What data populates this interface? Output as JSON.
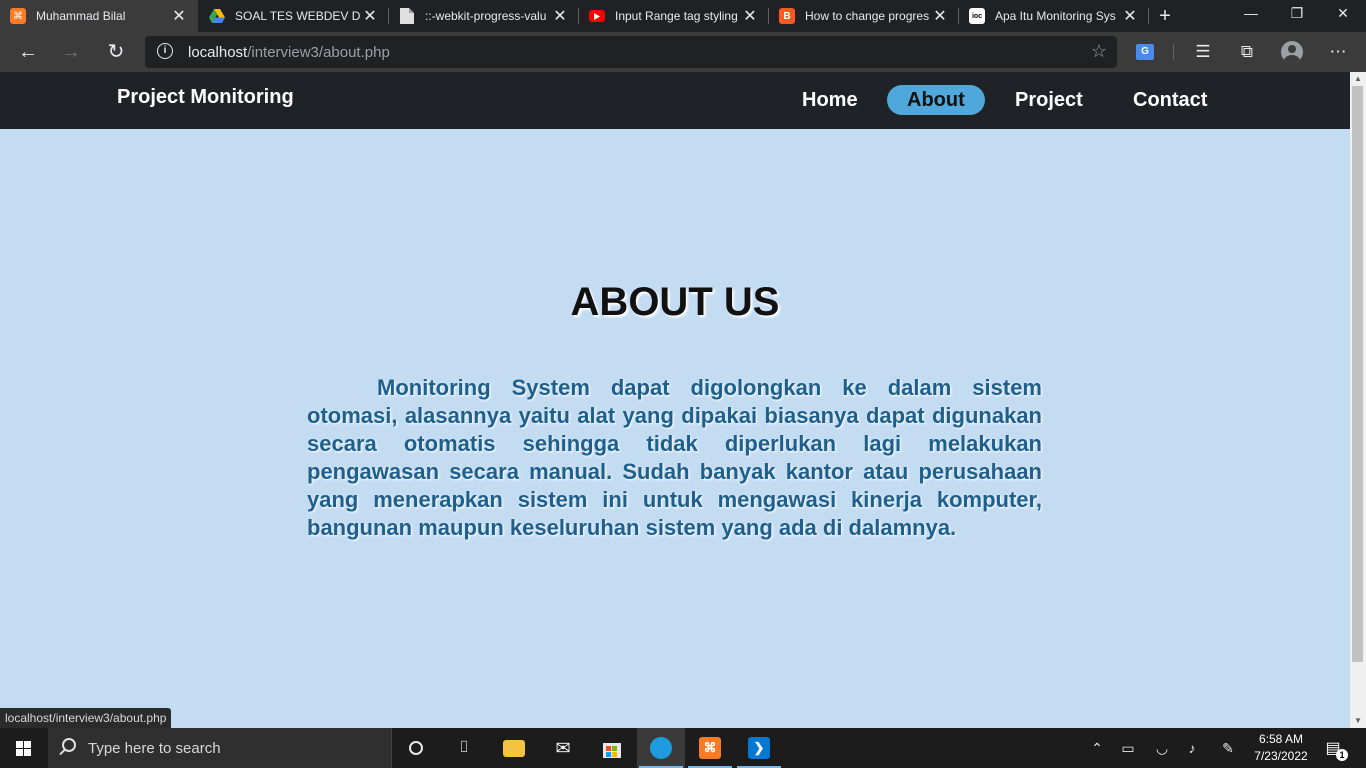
{
  "browser": {
    "tabs": [
      {
        "title": "Muhammad Bilal",
        "icon": "xampp-icon",
        "color": "#fb7a24",
        "active": true
      },
      {
        "title": "SOAL TES WEBDEV DIG",
        "icon": "google-drive-icon",
        "color": "#34a853",
        "active": false
      },
      {
        "title": "::-webkit-progress-valu",
        "icon": "document-icon",
        "color": "#d0d0d0",
        "active": false
      },
      {
        "title": "Input Range tag styling",
        "icon": "youtube-icon",
        "color": "#ff0000",
        "active": false
      },
      {
        "title": "How to change progres",
        "icon": "blogger-icon",
        "color": "#ff5722",
        "active": false
      },
      {
        "title": "Apa Itu Monitoring Sys",
        "icon": "ioc-icon",
        "color": "#ffffff",
        "active": false
      }
    ],
    "url_host": "localhost",
    "url_path": "/interview3/about.php",
    "status_url": "localhost/interview3/about.php"
  },
  "site": {
    "brand": "Project Monitoring",
    "menu": [
      {
        "label": "Home",
        "active": false
      },
      {
        "label": "About",
        "active": true
      },
      {
        "label": "Project",
        "active": false
      },
      {
        "label": "Contact",
        "active": false
      }
    ],
    "heading": "ABOUT US",
    "paragraph": "Monitoring System dapat digolongkan ke dalam sistem otomasi, alasannya yaitu alat yang dipakai biasanya dapat digunakan secara otomatis sehingga tidak diperlukan lagi melakukan pengawasan secara manual. Sudah banyak kantor atau perusahaan yang menerapkan sistem ini untuk mengawasi kinerja komputer, bangunan maupun keseluruhan sistem yang ada di dalamnya.",
    "colors": {
      "navbar": "#1f2328",
      "background": "#c4dcf2",
      "active_pill": "#4ea8dc",
      "paragraph": "#1f5f8b"
    }
  },
  "taskbar": {
    "search_placeholder": "Type here to search",
    "time": "6:58 AM",
    "date": "7/23/2022",
    "notification_count": "1"
  }
}
